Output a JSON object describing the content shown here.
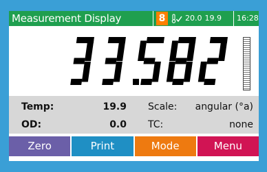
{
  "window": {
    "title": "Measurement Display"
  },
  "status": {
    "alarm_indicator": "8",
    "sensor_values": [
      "20.0",
      "19.9"
    ],
    "time": "16:28"
  },
  "reading": {
    "value": "33.582",
    "bargraph_fill": 0.0
  },
  "info": {
    "rows": [
      {
        "label": "Temp:",
        "value": "19.9",
        "label2": "Scale:",
        "value2": "angular (°a)"
      },
      {
        "label": "OD:",
        "value": "0.0",
        "label2": "TC:",
        "value2": "none"
      }
    ]
  },
  "buttons": [
    {
      "label": "Zero",
      "color": "#6b5fa8"
    },
    {
      "label": "Print",
      "color": "#1f8fc4"
    },
    {
      "label": "Mode",
      "color": "#ee7a10"
    },
    {
      "label": "Menu",
      "color": "#d11454"
    }
  ],
  "colors": {
    "background": "#3a9fd6",
    "statusbar": "#1f9f4f",
    "alarm": "#ff8000",
    "panel": "#ffffff",
    "info_panel": "#d7d7d7"
  },
  "icons": [
    "thermometer-check-icon",
    "bargraph-icon"
  ]
}
